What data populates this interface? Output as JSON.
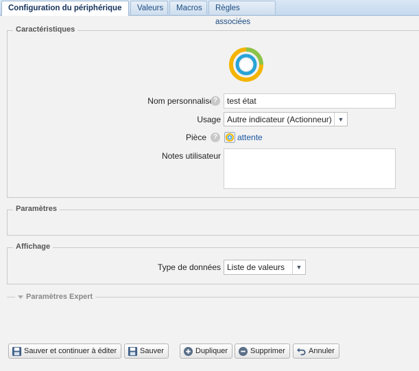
{
  "tabs": [
    {
      "label": "Configuration du périphérique",
      "active": true
    },
    {
      "label": "Valeurs",
      "active": false
    },
    {
      "label": "Macros",
      "active": false
    },
    {
      "label": "Règles associées",
      "active": false
    }
  ],
  "sections": {
    "characteristics": "Caractéristiques",
    "parameters": "Paramètres",
    "display": "Affichage",
    "expert": "Paramètres Expert"
  },
  "device_icon": "ring-indicator-icon",
  "form": {
    "name_label": "Nom personnalisé",
    "name_value": "test état",
    "usage_label": "Usage",
    "usage_value": "Autre indicateur (Actionneur)",
    "room_label": "Pièce",
    "room_value": "attente",
    "notes_label": "Notes utilisateur",
    "notes_value": "",
    "data_type_label": "Type de données",
    "data_type_value": "Liste de valeurs"
  },
  "buttons": {
    "save_continue": "Sauver et continuer à éditer",
    "save": "Sauver",
    "duplicate": "Dupliquer",
    "delete": "Supprimer",
    "cancel": "Annuler"
  },
  "colors": {
    "tab_text": "#1c4c82",
    "link": "#1a55a0",
    "ring_outer": "#f4b400",
    "ring_green": "#8bc34a",
    "ring_inner": "#29a3d6"
  }
}
